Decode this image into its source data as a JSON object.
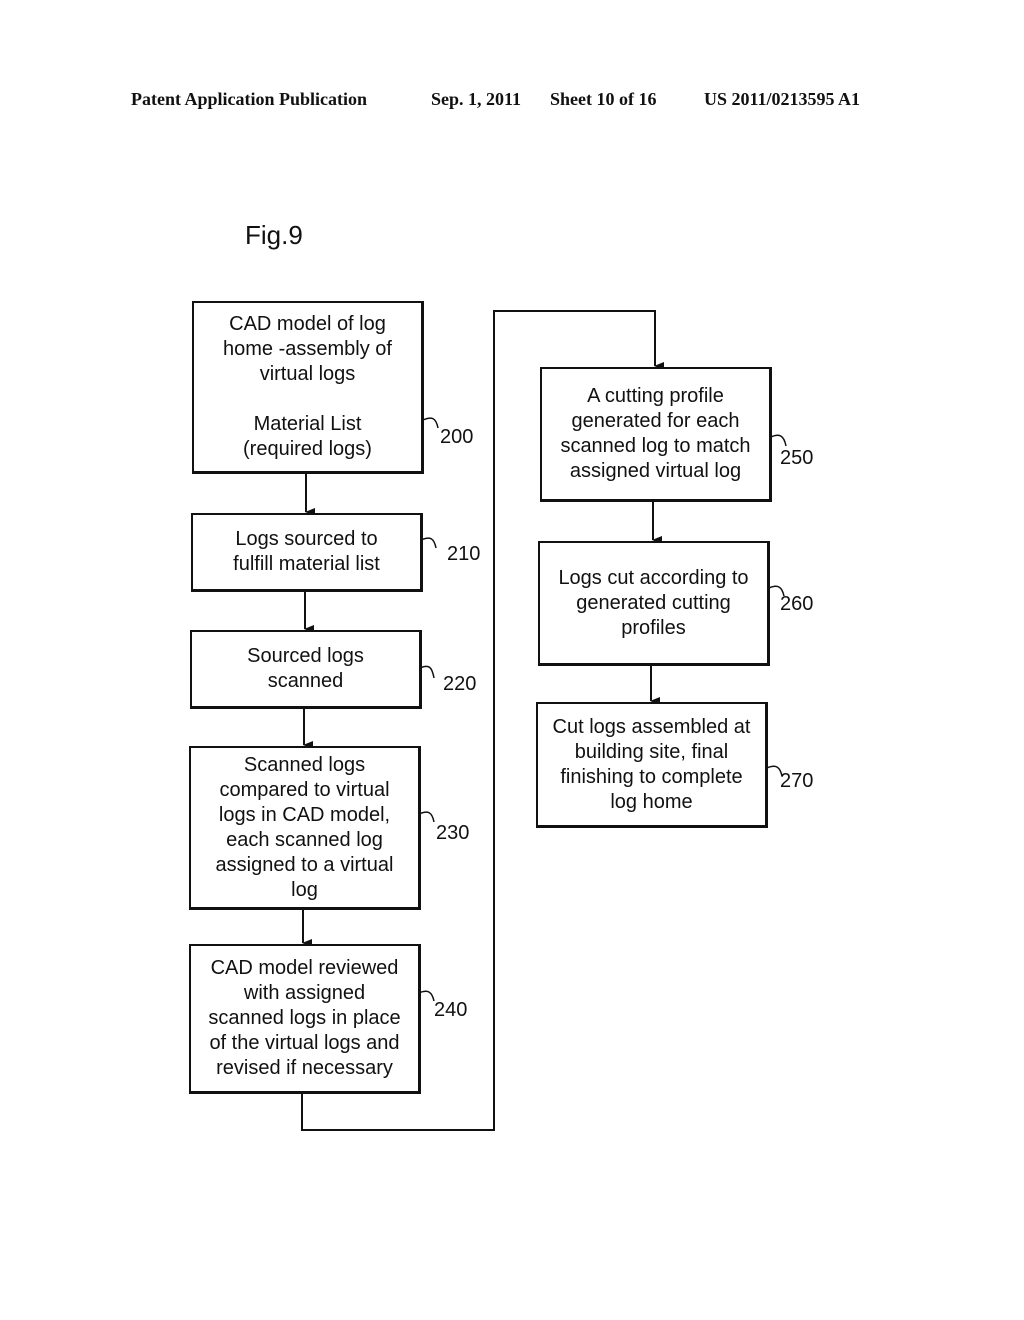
{
  "header": {
    "publication": "Patent Application Publication",
    "date": "Sep. 1, 2011",
    "sheet": "Sheet 10 of 16",
    "number": "US 2011/0213595 A1"
  },
  "figure": {
    "label": "Fig.9",
    "steps": [
      {
        "ref": "200",
        "lines": [
          "CAD model of log",
          "home -assembly of",
          "virtual logs"
        ],
        "lines2": [
          "Material List",
          "(required logs)"
        ]
      },
      {
        "ref": "210",
        "lines": [
          "Logs sourced to",
          "fulfill material list"
        ]
      },
      {
        "ref": "220",
        "lines": [
          "Sourced logs",
          "scanned"
        ]
      },
      {
        "ref": "230",
        "lines": [
          "Scanned logs",
          "compared to virtual",
          "logs in CAD model,",
          "each scanned log",
          "assigned to a virtual",
          "log"
        ]
      },
      {
        "ref": "240",
        "lines": [
          "CAD model reviewed",
          "with assigned",
          "scanned logs in place",
          "of the virtual logs and",
          "revised if necessary"
        ]
      },
      {
        "ref": "250",
        "lines": [
          "A cutting profile",
          "generated for each",
          "scanned log to match",
          "assigned virtual log"
        ]
      },
      {
        "ref": "260",
        "lines": [
          "Logs cut according to",
          "generated cutting",
          "profiles"
        ]
      },
      {
        "ref": "270",
        "lines": [
          "Cut logs assembled at",
          "building site, final",
          "finishing to complete",
          "log home"
        ]
      }
    ]
  }
}
